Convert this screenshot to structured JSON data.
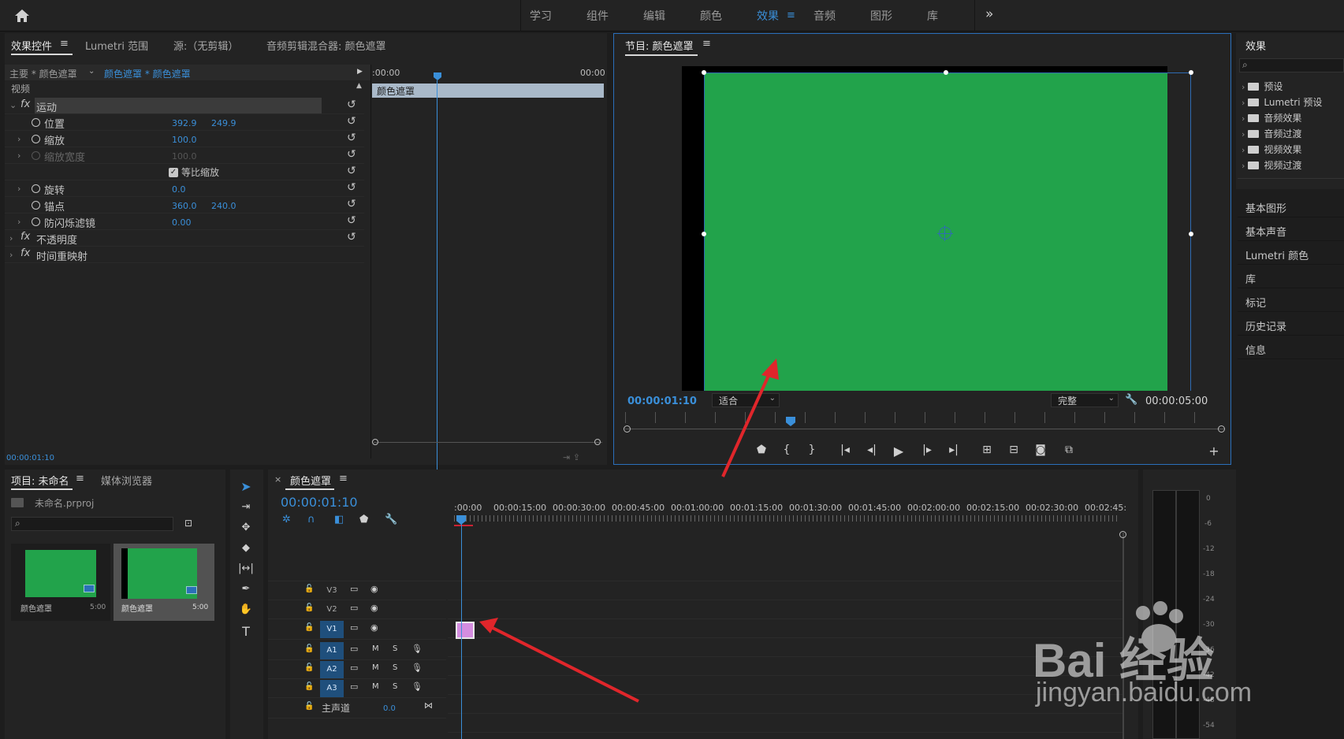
{
  "topbar": {
    "home_icon": "home-icon",
    "workspaces": [
      "学习",
      "组件",
      "编辑",
      "颜色",
      "效果",
      "音频",
      "图形",
      "库"
    ],
    "active_workspace": "效果",
    "overflow": "»"
  },
  "effect_controls": {
    "tabs": [
      "效果控件",
      "Lumetri 范围",
      "源:（无剪辑）",
      "音频剪辑混合器: 颜色遮罩"
    ],
    "master_label": "主要 * 颜色遮罩",
    "clip_label": "颜色遮罩 * 颜色遮罩",
    "section_video": "视频",
    "motion": "运动",
    "properties": [
      {
        "name": "位置",
        "v1": "392.9",
        "v2": "249.9"
      },
      {
        "name": "缩放",
        "v1": "100.0",
        "v2": ""
      },
      {
        "name": "缩放宽度",
        "v1": "100.0",
        "v2": ""
      },
      {
        "name": "等比缩放",
        "v1": "",
        "v2": ""
      },
      {
        "name": "旋转",
        "v1": "0.0",
        "v2": ""
      },
      {
        "name": "锚点",
        "v1": "360.0",
        "v2": "240.0"
      },
      {
        "name": "防闪烁滤镜",
        "v1": "0.00",
        "v2": ""
      }
    ],
    "opacity": "不透明度",
    "time_remap": "时间重映射",
    "mini_timeline": {
      "start": ":00:00",
      "end": "00:00",
      "clip": "颜色遮罩"
    },
    "timecode": "00:00:01:10"
  },
  "program_monitor": {
    "title": "节目: 颜色遮罩",
    "timecode": "00:00:01:10",
    "fit": "适合",
    "quality": "完整",
    "duration": "00:00:05:00",
    "frame_color": "#22a34b"
  },
  "effects_panel": {
    "title": "效果",
    "search_placeholder": "",
    "tree": [
      "预设",
      "Lumetri 预设",
      "音频效果",
      "音频过渡",
      "视频效果",
      "视频过渡"
    ],
    "side_panels": [
      "基本图形",
      "基本声音",
      "Lumetri 颜色",
      "库",
      "标记",
      "历史记录",
      "信息"
    ]
  },
  "project": {
    "tabs": [
      "项目: 未命名",
      "媒体浏览器"
    ],
    "filename": "未命名.prproj",
    "items": [
      {
        "name": "颜色遮罩",
        "duration": "5:00"
      },
      {
        "name": "颜色遮罩",
        "duration": "5:00"
      }
    ]
  },
  "timeline": {
    "close": "×",
    "title": "颜色遮罩",
    "timecode": "00:00:01:10",
    "ruler": [
      ":00:00",
      "00:00:15:00",
      "00:00:30:00",
      "00:00:45:00",
      "00:01:00:00",
      "00:01:15:00",
      "00:01:30:00",
      "00:01:45:00",
      "00:02:00:00",
      "00:02:15:00",
      "00:02:30:00",
      "00:02:45:"
    ],
    "video_tracks": [
      "V3",
      "V2",
      "V1"
    ],
    "audio_tracks": [
      "A1",
      "A2",
      "A3"
    ],
    "mix_label": "M",
    "solo_label": "S",
    "master": "主声道",
    "master_value": "0.0",
    "clip_color": "#d58de0"
  },
  "meters": {
    "levels": [
      "0",
      "-6",
      "-12",
      "-18",
      "-24",
      "-30",
      "-36",
      "-42",
      "-48",
      "-54"
    ]
  },
  "watermark": {
    "text1": "Bai 经验",
    "text2": "jingyan.baidu.com"
  }
}
